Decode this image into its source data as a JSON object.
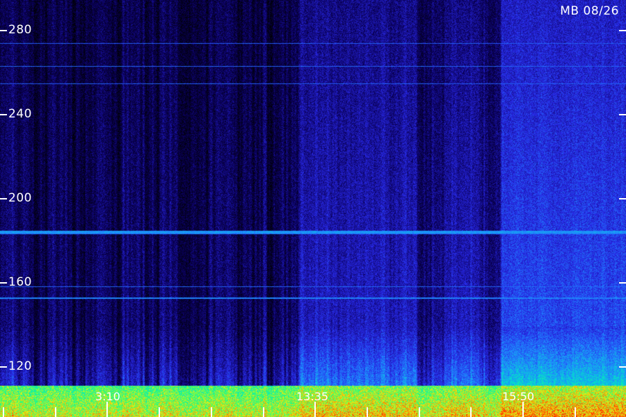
{
  "station_label": "MB 08/26",
  "y_axis": {
    "ticks": [
      "280",
      "240",
      "200",
      "160",
      "120"
    ]
  },
  "x_axis": {
    "labels": [
      "3:10",
      "13:35",
      "15:50"
    ]
  },
  "colors": {
    "background": "#000000",
    "low": "#00008b",
    "mid": "#1e90ff",
    "high": "#00ff80",
    "peak": "#ff3000",
    "text": "#ffffff"
  }
}
